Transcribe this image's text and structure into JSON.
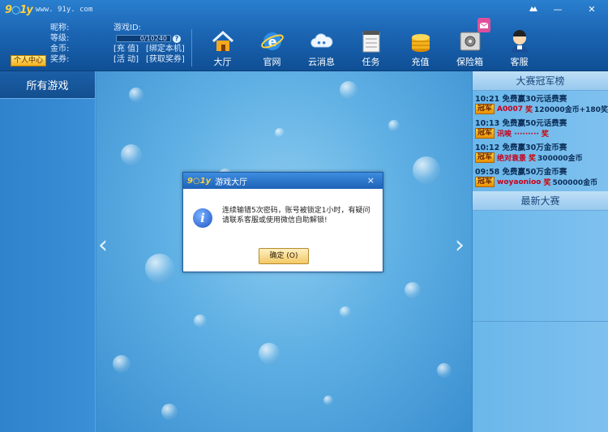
{
  "app": {
    "logo_text_a": "9",
    "logo_text_b": "1y",
    "logo_url": "www. 91y. com"
  },
  "user": {
    "nickname_label": "昵称:",
    "game_id_label": "游戏ID:",
    "level_label": "等级:",
    "exp_value": "0/10240",
    "gold_label": "金币:",
    "recharge_link": "[充 值]",
    "bind_link": "[绑定本机]",
    "ticket_label": "奖券:",
    "activity_link": "[活 动]",
    "get_ticket_link": "[获取奖券]",
    "personal_center": "个人中心",
    "help_symbol": "?"
  },
  "nav": {
    "hall": "大厅",
    "website": "官网",
    "cloud_message": "云消息",
    "tasks": "任务",
    "recharge": "充值",
    "safe_box": "保险箱",
    "service": "客服"
  },
  "sidebar": {
    "title": "所有游戏"
  },
  "right_panel": {
    "champions_title": "大赛冠军榜",
    "champion_badge": "冠军",
    "prize_word": "奖",
    "champions": [
      {
        "time_event": "10:21 免费赢30元话费赛",
        "player": "A0007",
        "prize": "120000金币+180奖"
      },
      {
        "time_event": "10:13 免费赢50元话费赛",
        "player": "讯唉 ·········",
        "prize": ""
      },
      {
        "time_event": "10:12 免费赢30万金币赛",
        "player": "绝对衰景",
        "prize": "300000金币"
      },
      {
        "time_event": "09:58 免费赢50万金币赛",
        "player": "woyaonioo",
        "prize": "500000金币"
      }
    ],
    "latest_title": "最新大赛"
  },
  "dialog": {
    "title": "游戏大厅",
    "close": "×",
    "message": "连续输错5次密码，账号被锁定1小时，有疑问请联系客服或使用微信自助解锁!",
    "ok_button": "确定 (O)"
  },
  "window": {
    "minimize": "—",
    "close": "✕",
    "skin": "⚙"
  },
  "arrows": {
    "left": "‹",
    "right": "›"
  }
}
